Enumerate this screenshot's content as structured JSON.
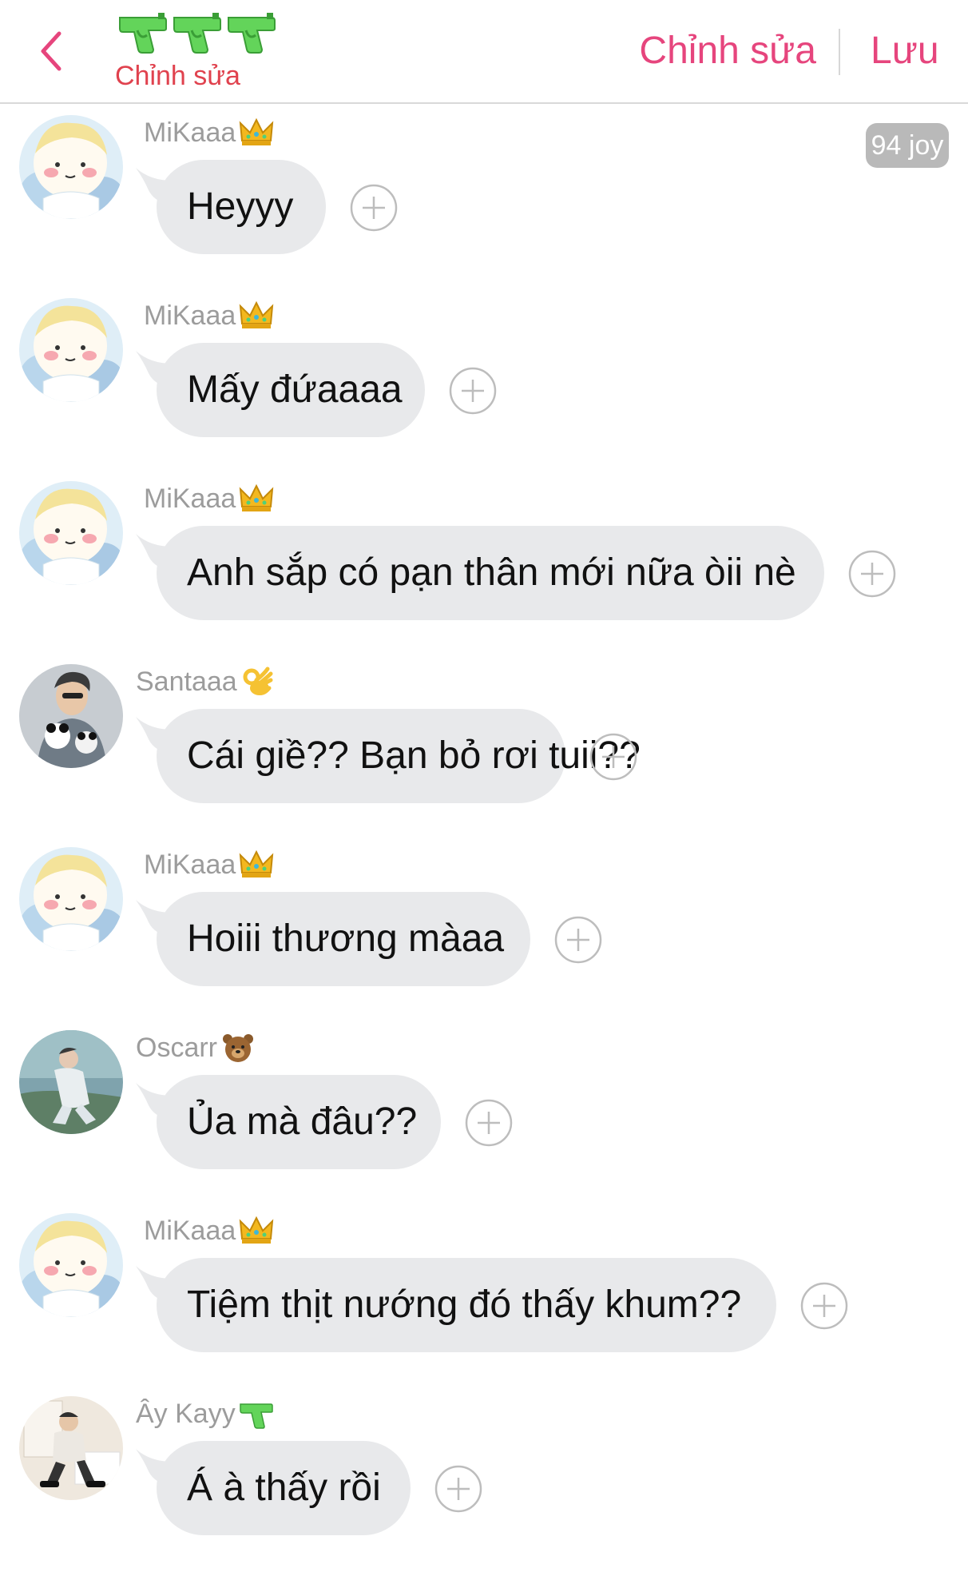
{
  "header": {
    "title_label": "Chỉnh sửa",
    "edit_label": "Chỉnh sửa",
    "save_label": "Lưu",
    "accent_color": "#e6457d",
    "icons": [
      "chevron-left-icon",
      "water-gun-icon",
      "water-gun-icon",
      "water-gun-icon"
    ]
  },
  "joy_badge": "94 joy",
  "messages": [
    {
      "sender": "MiKaaa",
      "emoji": "crown-icon",
      "text": "Heyyy"
    },
    {
      "sender": "MiKaaa",
      "emoji": "crown-icon",
      "text": "Mấy đứaaaa"
    },
    {
      "sender": "MiKaaa",
      "emoji": "crown-icon",
      "text": "Anh sắp có pạn thân mới nữa òii nè"
    },
    {
      "sender": "Santaaa",
      "emoji": "ok-hand-icon",
      "text": "Cái giề?? Bạn bỏ rơi tuii??"
    },
    {
      "sender": "MiKaaa",
      "emoji": "crown-icon",
      "text": "Hoiii thương màaa"
    },
    {
      "sender": "Oscarr",
      "emoji": "bear-icon",
      "text": "Ủa mà đâu??"
    },
    {
      "sender": "MiKaaa",
      "emoji": "crown-icon",
      "text": "Tiệm thịt nướng đó thấy khum??"
    },
    {
      "sender": "Ây Kayy",
      "emoji": "water-gun-icon",
      "text": "Á à thấy rồi"
    }
  ]
}
